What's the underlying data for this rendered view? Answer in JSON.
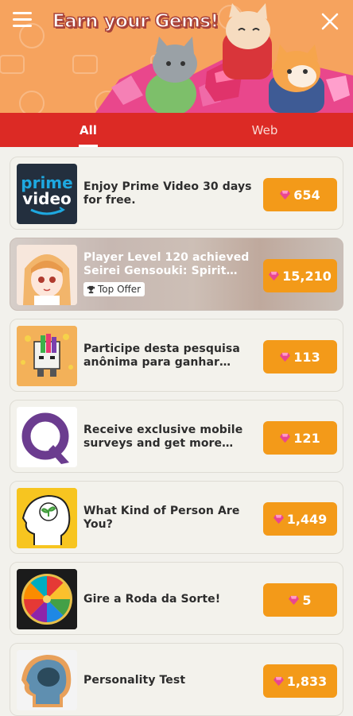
{
  "header": {
    "title": "Earn your Gems!",
    "menu_icon": "hamburger-menu-icon",
    "close_icon": "close-icon",
    "background_color": "#f6a35e"
  },
  "tabs": [
    {
      "label": "All",
      "active": true
    },
    {
      "label": "Web",
      "active": false
    }
  ],
  "tabs_color": "#dc2a25",
  "gem_button_color": "#f39a19",
  "offers": [
    {
      "title": "Enjoy Prime Video 30 days for free.",
      "gems": "654",
      "icon": "prime-video-logo"
    },
    {
      "title": "Player Level 120 achieved Seirei Gensouki: Spirit…",
      "gems": "15,210",
      "badge": "Top Offer",
      "icon": "anime-girl-thumbnail",
      "featured": true
    },
    {
      "title": "Participe desta pesquisa anônima para ganhar…",
      "gems": "113",
      "icon": "survey-character-thumbnail"
    },
    {
      "title": "Receive exclusive mobile surveys and get more…",
      "gems": "121",
      "icon": "q-logo"
    },
    {
      "title": "What Kind of Person Are You?",
      "gems": "1,449",
      "icon": "head-plant-thumbnail"
    },
    {
      "title": "Gire a Roda da Sorte!",
      "gems": "5",
      "icon": "fortune-wheel-thumbnail"
    },
    {
      "title": "Personality Test",
      "gems": "1,833",
      "icon": "head-silhouette-thumbnail"
    }
  ]
}
